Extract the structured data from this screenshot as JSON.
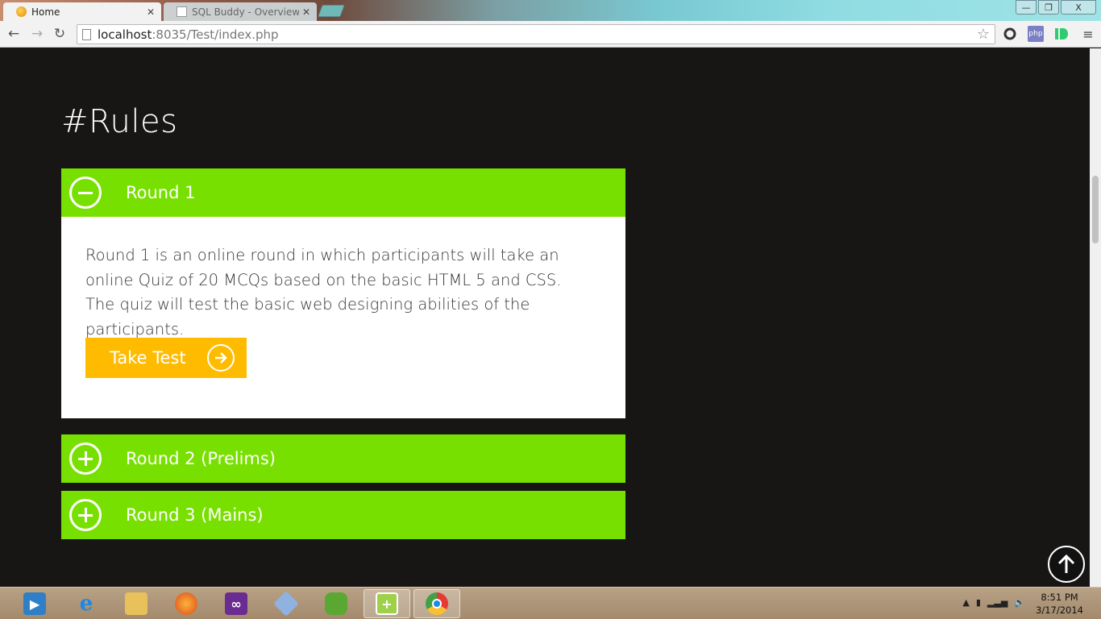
{
  "browser": {
    "tabs": [
      {
        "label": "Home",
        "active": true,
        "icon": "home-favicon"
      },
      {
        "label": "SQL Buddy - Overview - sp",
        "active": false,
        "icon": "document-favicon"
      }
    ],
    "url": {
      "host": "localhost",
      "rest": ":8035/Test/index.php"
    },
    "window_buttons": {
      "minimize": "—",
      "restore": "❐",
      "close": "X"
    },
    "extensions": [
      "chrome-ext-circle-icon",
      "php-ext-icon",
      "green-ext-icon"
    ],
    "extension_labels": {
      "php": "php"
    }
  },
  "page": {
    "heading": "#Rules",
    "accordion": [
      {
        "title": "Round 1",
        "expanded": true,
        "body": "Round 1 is an online round in which participants will take an online Quiz of 20 MCQs based on the basic HTML 5 and CSS. The quiz will test the basic web designing abilities of the participants.",
        "button": "Take Test"
      },
      {
        "title": "Round 2 (Prelims)",
        "expanded": false
      },
      {
        "title": "Round 3 (Mains)",
        "expanded": false
      }
    ],
    "colors": {
      "accent_green": "#78e000",
      "button_yellow": "#ffbb00",
      "background": "#171614"
    }
  },
  "taskbar": {
    "apps": [
      "media-center-icon",
      "internet-explorer-icon",
      "file-explorer-icon",
      "firefox-icon",
      "visual-studio-icon",
      "virtualbox-icon",
      "evernote-icon",
      "notepad-plus-plus-icon",
      "chrome-icon"
    ],
    "clock": {
      "time": "8:51 PM",
      "date": "3/17/2014"
    }
  }
}
